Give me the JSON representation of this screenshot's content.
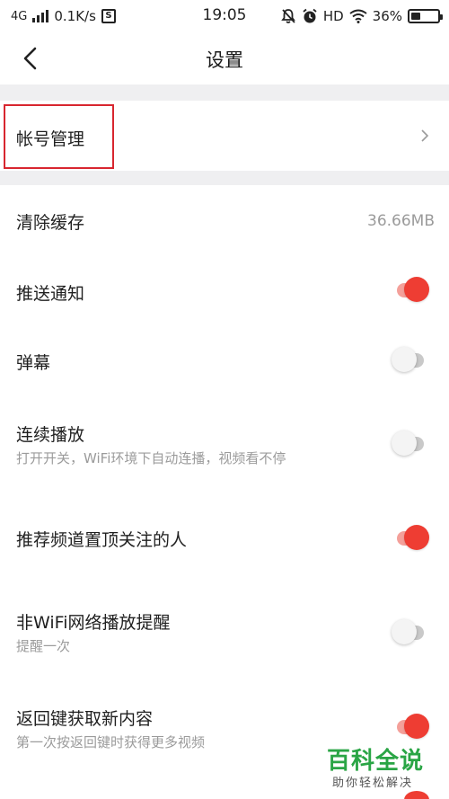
{
  "status_bar": {
    "network": "4G",
    "speed": "0.1K/s",
    "sim_badge": "S",
    "time": "19:05",
    "hd": "HD",
    "battery": "36%",
    "battery_level": 0.36,
    "icons": [
      "signal-bars-icon",
      "sim-icon",
      "mute-bell-icon",
      "alarm-icon",
      "wifi-icon",
      "battery-icon"
    ]
  },
  "header": {
    "title": "设置",
    "back_icon": "chevron-left-icon"
  },
  "account": {
    "label": "帐号管理",
    "chevron_icon": "chevron-right-icon"
  },
  "settings": [
    {
      "id": "clear-cache",
      "title": "清除缓存",
      "value": "36.66MB"
    },
    {
      "id": "push-notification",
      "title": "推送通知",
      "on": true
    },
    {
      "id": "danmaku",
      "title": "弹幕",
      "on": false
    },
    {
      "id": "autoplay",
      "title": "连续播放",
      "subtitle": "打开开关，WiFi环境下自动连播，视频看不停",
      "on": false
    },
    {
      "id": "pin-followed",
      "title": "推荐频道置顶关注的人",
      "on": true
    },
    {
      "id": "non-wifi-reminder",
      "title": "非WiFi网络播放提醒",
      "subtitle": "提醒一次",
      "on": false
    },
    {
      "id": "back-refresh",
      "title": "返回键获取新内容",
      "subtitle": "第一次按返回键时获得更多视频",
      "on": true
    }
  ],
  "watermark": {
    "title": "百科全说",
    "subtitle": "助你轻松解决"
  },
  "colors": {
    "accent": "#ee3d33",
    "accent_track": "#f4a09a",
    "off_track": "#c9c9c9",
    "divider_band": "#efeff1",
    "highlight": "#d8262f",
    "watermark": "#2aa545",
    "secondary_text": "#9b9b9b"
  }
}
